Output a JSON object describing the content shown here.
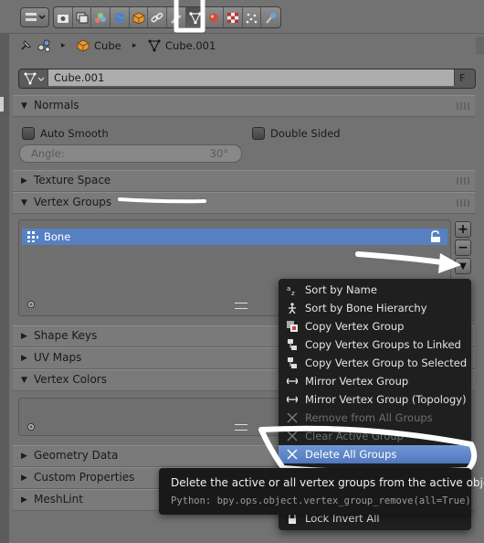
{
  "breadcrumb": {
    "object": "Cube",
    "mesh": "Cube.001"
  },
  "datablock": {
    "name": "Cube.001",
    "fake_user": "F"
  },
  "normals": {
    "title": "Normals",
    "auto_smooth": "Auto Smooth",
    "double_sided": "Double Sided",
    "angle_label": "Angle:",
    "angle_value": "30°"
  },
  "panels": {
    "texture_space": "Texture Space",
    "vertex_groups": "Vertex Groups",
    "shape_keys": "Shape Keys",
    "uv_maps": "UV Maps",
    "vertex_colors": "Vertex Colors",
    "geometry_data": "Geometry Data",
    "custom_properties": "Custom Properties",
    "meshlint": "MeshLint"
  },
  "vertex_groups": {
    "items": [
      {
        "name": "Bone"
      }
    ],
    "add": "+",
    "remove": "−",
    "specials": "▼"
  },
  "menu": {
    "items": [
      {
        "label": "Sort by Name",
        "icon": "sort-alpha-icon",
        "state": "normal"
      },
      {
        "label": "Sort by Bone Hierarchy",
        "icon": "bone-icon",
        "state": "normal"
      },
      {
        "label": "Copy Vertex Group",
        "icon": "copy-icon",
        "state": "normal"
      },
      {
        "label": "Copy Vertex Groups to Linked",
        "icon": "link-icon",
        "state": "normal"
      },
      {
        "label": "Copy Vertex Group to Selected",
        "icon": "link-icon",
        "state": "normal"
      },
      {
        "label": "Mirror Vertex Group",
        "icon": "mirror-icon",
        "state": "normal"
      },
      {
        "label": "Mirror Vertex Group (Topology)",
        "icon": "mirror-icon",
        "state": "normal"
      },
      {
        "label": "Remove from All Groups",
        "icon": "x-icon",
        "state": "disabled"
      },
      {
        "label": "Clear Active Group",
        "icon": "x-icon",
        "state": "disabled"
      },
      {
        "label": "Delete All Groups",
        "icon": "x-icon",
        "state": "highlight"
      },
      {
        "label": "",
        "icon": "",
        "state": "hidden"
      },
      {
        "label": "",
        "icon": "",
        "state": "hidden"
      },
      {
        "label": "Lock Invert All",
        "icon": "lock-icon",
        "state": "normal"
      }
    ]
  },
  "tooltip": {
    "text": "Delete the active or all vertex groups from the active object",
    "python": "Python: bpy.ops.object.vertex_group_remove(all=True)"
  },
  "colors": {
    "accent": "#5680c2",
    "highlight": "#5a82c6",
    "annotation": "#ffffff"
  }
}
